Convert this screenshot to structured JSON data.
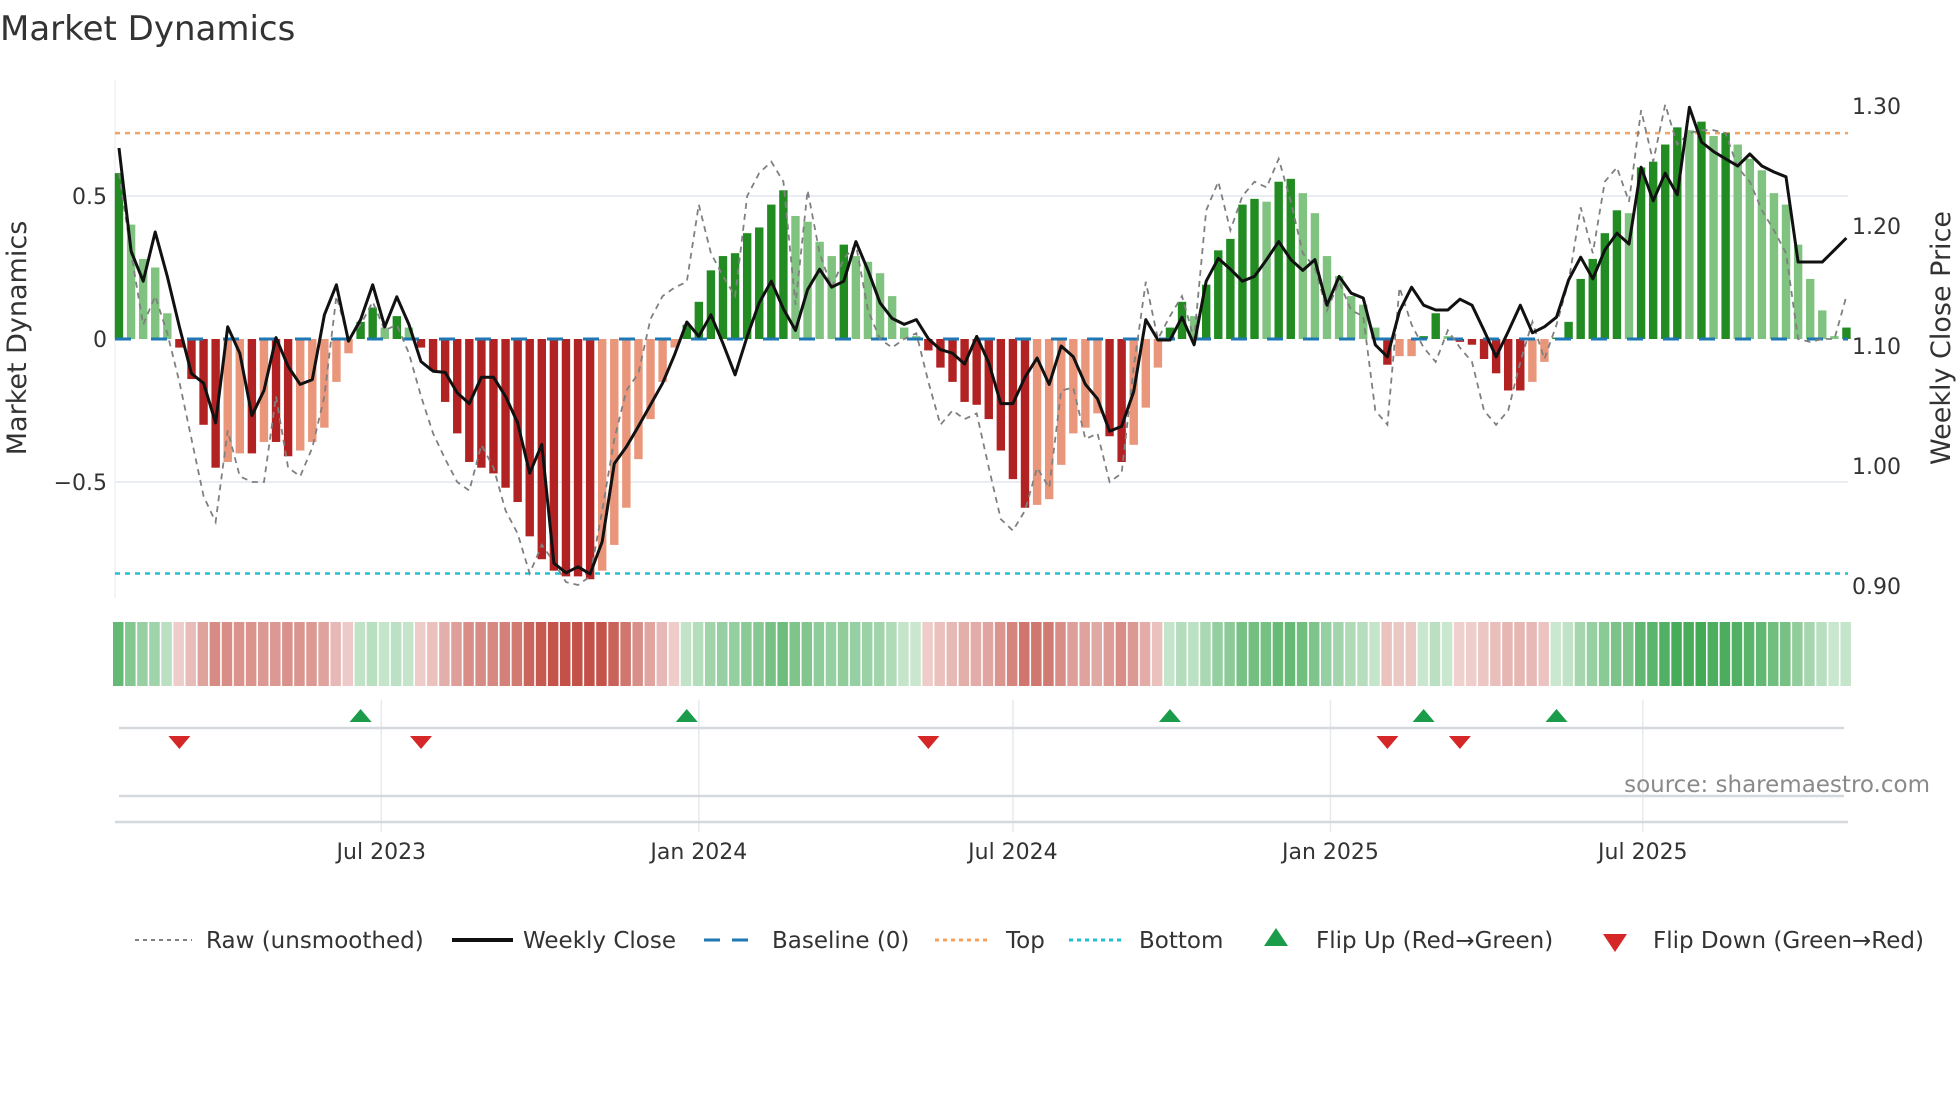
{
  "title": "Market Dynamics",
  "source": "source: sharemaestro.com",
  "colors": {
    "strong_green": "#228b22",
    "weak_green": "#80c27f",
    "strong_red": "#b22222",
    "weak_red": "#e9967a",
    "close_line": "#111111",
    "raw_line": "#808080",
    "baseline": "#1f77b4",
    "top": "#f4a460",
    "bottom": "#22c0d6",
    "flip_up": "#1a9c4a",
    "flip_down": "#d62728",
    "strip_green": "46,160,67",
    "strip_red": "192,72,62"
  },
  "chart_data": {
    "type": "bar",
    "title": "Market Dynamics",
    "xlabel": "",
    "ylabel": "Market Dynamics",
    "y2label": "Weekly Close Price",
    "start_date": "2023-01-30",
    "frequency": "weekly",
    "ylim": [
      -0.92,
      0.9
    ],
    "y2lim": [
      0.885,
      1.315
    ],
    "yticks": [
      {
        "v": 0.5,
        "label": "0.5"
      },
      {
        "v": 0,
        "label": "0"
      },
      {
        "v": -0.5,
        "label": "−0.5"
      }
    ],
    "y2ticks": [
      {
        "v": 1.3,
        "label": "1.30"
      },
      {
        "v": 1.2,
        "label": "1.20"
      },
      {
        "v": 1.1,
        "label": "1.10"
      },
      {
        "v": 1.0,
        "label": "1.00"
      },
      {
        "v": 0.9,
        "label": "0.90"
      }
    ],
    "xticks": [
      {
        "date": "2023-07-01",
        "label": "Jul 2023"
      },
      {
        "date": "2024-01-01",
        "label": "Jan 2024"
      },
      {
        "date": "2024-07-01",
        "label": "Jul 2024"
      },
      {
        "date": "2025-01-01",
        "label": "Jan 2025"
      },
      {
        "date": "2025-07-01",
        "label": "Jul 2025"
      }
    ],
    "thresholds": {
      "top": 0.72,
      "bottom": -0.82,
      "baseline": 0
    },
    "dynamics": [
      0.58,
      0.4,
      0.28,
      0.25,
      0.09,
      -0.03,
      -0.14,
      -0.3,
      -0.45,
      -0.43,
      -0.4,
      -0.4,
      -0.36,
      -0.36,
      -0.41,
      -0.39,
      -0.36,
      -0.31,
      -0.15,
      -0.05,
      0.06,
      0.11,
      0.04,
      0.08,
      0.04,
      -0.03,
      -0.11,
      -0.22,
      -0.33,
      -0.43,
      -0.45,
      -0.47,
      -0.52,
      -0.57,
      -0.69,
      -0.77,
      -0.81,
      -0.83,
      -0.83,
      -0.84,
      -0.81,
      -0.72,
      -0.59,
      -0.42,
      -0.28,
      -0.15,
      -0.03,
      0.05,
      0.13,
      0.24,
      0.29,
      0.3,
      0.37,
      0.39,
      0.47,
      0.52,
      0.43,
      0.41,
      0.34,
      0.29,
      0.33,
      0.29,
      0.27,
      0.23,
      0.15,
      0.04,
      0.01,
      -0.04,
      -0.1,
      -0.15,
      -0.22,
      -0.23,
      -0.28,
      -0.39,
      -0.49,
      -0.59,
      -0.58,
      -0.56,
      -0.44,
      -0.33,
      -0.31,
      -0.26,
      -0.34,
      -0.43,
      -0.37,
      -0.24,
      -0.1,
      0.04,
      0.13,
      0.08,
      0.19,
      0.31,
      0.35,
      0.47,
      0.49,
      0.48,
      0.55,
      0.56,
      0.51,
      0.44,
      0.29,
      0.22,
      0.15,
      0.12,
      0.04,
      -0.09,
      -0.06,
      -0.06,
      0.01,
      0.09,
      0.01,
      -0.01,
      -0.02,
      -0.07,
      -0.12,
      -0.18,
      -0.18,
      -0.15,
      -0.08,
      0.005,
      0.06,
      0.21,
      0.28,
      0.37,
      0.45,
      0.44,
      0.6,
      0.62,
      0.68,
      0.74,
      0.73,
      0.76,
      0.71,
      0.72,
      0.68,
      0.63,
      0.59,
      0.51,
      0.47,
      0.33,
      0.21,
      0.1,
      0.01,
      0.04
    ],
    "strong": [
      1,
      0,
      0,
      0,
      0,
      1,
      1,
      1,
      1,
      0,
      0,
      1,
      0,
      1,
      1,
      0,
      0,
      0,
      0,
      0,
      1,
      1,
      0,
      1,
      0,
      1,
      1,
      1,
      1,
      1,
      1,
      1,
      1,
      1,
      1,
      1,
      1,
      1,
      1,
      1,
      0,
      0,
      0,
      0,
      0,
      0,
      0,
      1,
      1,
      1,
      1,
      1,
      1,
      1,
      1,
      1,
      0,
      0,
      0,
      0,
      1,
      0,
      0,
      0,
      0,
      0,
      0,
      1,
      1,
      1,
      1,
      1,
      1,
      1,
      1,
      1,
      0,
      0,
      0,
      0,
      0,
      0,
      1,
      1,
      0,
      0,
      0,
      1,
      1,
      0,
      1,
      1,
      1,
      1,
      1,
      0,
      1,
      1,
      0,
      0,
      0,
      0,
      0,
      0,
      0,
      1,
      0,
      0,
      1,
      1,
      0,
      1,
      1,
      1,
      1,
      1,
      1,
      0,
      0,
      1,
      1,
      1,
      1,
      1,
      1,
      0,
      1,
      1,
      1,
      1,
      0,
      1,
      0,
      1,
      0,
      0,
      0,
      0,
      0,
      0,
      0,
      0,
      0,
      1
    ],
    "raw": [
      0.58,
      0.3,
      0.05,
      0.15,
      0.02,
      -0.15,
      -0.35,
      -0.55,
      -0.64,
      -0.32,
      -0.48,
      -0.5,
      -0.5,
      -0.2,
      -0.45,
      -0.48,
      -0.38,
      -0.2,
      0.15,
      0.0,
      0.05,
      0.13,
      0.03,
      0.05,
      -0.05,
      -0.2,
      -0.33,
      -0.42,
      -0.5,
      -0.53,
      -0.37,
      -0.45,
      -0.6,
      -0.68,
      -0.82,
      -0.72,
      -0.78,
      -0.85,
      -0.86,
      -0.83,
      -0.6,
      -0.35,
      -0.18,
      -0.12,
      0.07,
      0.15,
      0.18,
      0.2,
      0.47,
      0.3,
      0.22,
      0.15,
      0.5,
      0.58,
      0.62,
      0.55,
      0.12,
      0.52,
      0.3,
      0.18,
      0.28,
      0.33,
      0.1,
      0.0,
      -0.03,
      0.0,
      0.02,
      -0.15,
      -0.3,
      -0.25,
      -0.28,
      -0.26,
      -0.45,
      -0.63,
      -0.67,
      -0.6,
      -0.45,
      -0.52,
      -0.18,
      -0.17,
      -0.35,
      -0.33,
      -0.5,
      -0.47,
      -0.1,
      0.2,
      0.0,
      0.08,
      0.15,
      0.0,
      0.45,
      0.55,
      0.38,
      0.5,
      0.55,
      0.53,
      0.63,
      0.48,
      0.3,
      0.25,
      0.1,
      0.2,
      0.1,
      0.08,
      -0.25,
      -0.3,
      0.18,
      0.05,
      -0.03,
      -0.08,
      0.03,
      -0.03,
      -0.08,
      -0.25,
      -0.3,
      -0.25,
      -0.08,
      0.06,
      -0.07,
      0.05,
      0.2,
      0.46,
      0.3,
      0.55,
      0.6,
      0.48,
      0.8,
      0.62,
      0.82,
      0.68,
      0.72,
      0.73,
      0.73,
      0.72,
      0.6,
      0.55,
      0.45,
      0.38,
      0.3,
      0.0,
      -0.01,
      0.0,
      0.0,
      0.15
    ],
    "weekly_close": [
      1.265,
      1.179,
      1.154,
      1.195,
      1.158,
      1.116,
      1.077,
      1.069,
      1.036,
      1.116,
      1.094,
      1.042,
      1.063,
      1.107,
      1.083,
      1.068,
      1.072,
      1.126,
      1.151,
      1.104,
      1.122,
      1.151,
      1.116,
      1.141,
      1.118,
      1.087,
      1.079,
      1.078,
      1.061,
      1.052,
      1.074,
      1.074,
      1.058,
      1.036,
      0.994,
      1.018,
      0.919,
      0.911,
      0.916,
      0.91,
      0.937,
      1.002,
      1.016,
      1.033,
      1.051,
      1.069,
      1.093,
      1.12,
      1.108,
      1.126,
      1.102,
      1.076,
      1.108,
      1.136,
      1.154,
      1.131,
      1.113,
      1.147,
      1.164,
      1.149,
      1.154,
      1.187,
      1.163,
      1.136,
      1.123,
      1.118,
      1.122,
      1.106,
      1.097,
      1.094,
      1.085,
      1.108,
      1.086,
      1.052,
      1.052,
      1.074,
      1.09,
      1.068,
      1.1,
      1.091,
      1.068,
      1.056,
      1.029,
      1.033,
      1.062,
      1.122,
      1.105,
      1.105,
      1.124,
      1.101,
      1.154,
      1.173,
      1.164,
      1.154,
      1.158,
      1.172,
      1.187,
      1.172,
      1.163,
      1.172,
      1.134,
      1.158,
      1.144,
      1.14,
      1.101,
      1.091,
      1.129,
      1.149,
      1.134,
      1.13,
      1.13,
      1.139,
      1.134,
      1.113,
      1.091,
      1.112,
      1.134,
      1.111,
      1.116,
      1.124,
      1.155,
      1.174,
      1.156,
      1.18,
      1.194,
      1.185,
      1.249,
      1.221,
      1.244,
      1.226,
      1.299,
      1.27,
      1.262,
      1.256,
      1.25,
      1.26,
      1.25,
      1.245,
      1.241,
      1.17,
      1.17,
      1.17,
      1.18,
      1.19
    ],
    "flip_up_weeks": [
      21,
      48,
      88,
      109,
      120
    ],
    "flip_down_weeks": [
      6,
      26,
      68,
      106,
      112
    ],
    "legend": {
      "placement": "bottom",
      "raw": "Raw (unsmoothed)",
      "close": "Weekly Close",
      "baseline": "Baseline (0)",
      "top": "Top",
      "bottom": "Bottom",
      "flip_up": "Flip Up (Red→Green)",
      "flip_down": "Flip Down (Green→Red)"
    }
  }
}
